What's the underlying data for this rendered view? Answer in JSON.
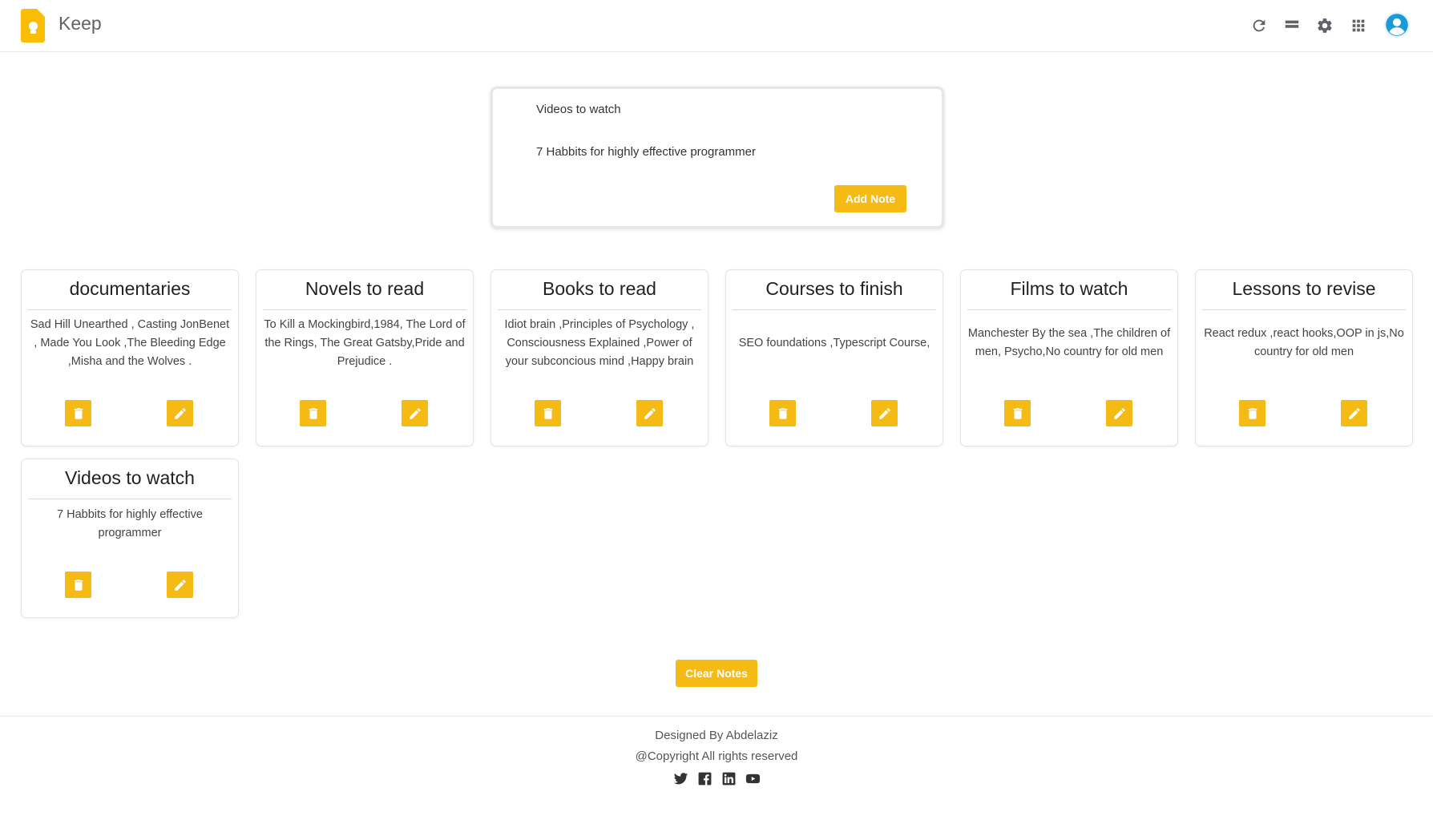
{
  "header": {
    "app_title": "Keep",
    "icons": [
      "refresh-icon",
      "list-view-icon",
      "settings-icon",
      "apps-grid-icon",
      "account-avatar"
    ]
  },
  "create_note": {
    "title_value": "Videos to watch",
    "content_value": "7 Habbits for highly effective programmer",
    "add_label": "Add Note"
  },
  "notes": [
    {
      "title": "documentaries",
      "content": "Sad Hill Unearthed , Casting JonBenet , Made You Look ,The Bleeding Edge ,Misha and the Wolves ."
    },
    {
      "title": "Novels to read",
      "content": "To Kill a Mockingbird,1984, The Lord of the Rings, The Great Gatsby,Pride and Prejudice ."
    },
    {
      "title": "Books to read",
      "content": "Idiot brain ,Principles of Psychology , Consciousness Explained ,Power of your subconcious mind ,Happy brain"
    },
    {
      "title": "Courses to finish",
      "content": "SEO foundations ,Typescript Course,"
    },
    {
      "title": "Films to watch",
      "content": "Manchester By the sea ,The children of men, Psycho,No country for old men"
    },
    {
      "title": "Lessons to revise",
      "content": "React redux ,react hooks,OOP in js,No country for old men"
    },
    {
      "title": "Videos to watch",
      "content": "7 Habbits for highly effective programmer"
    }
  ],
  "clear_label": "Clear Notes",
  "footer": {
    "designed_by": "Designed By Abdelaziz",
    "copyright": "@Copyright All rights reserved",
    "social_icons": [
      "twitter-icon",
      "facebook-icon",
      "linkedin-icon",
      "youtube-icon"
    ]
  },
  "colors": {
    "accent": "#f5ba13",
    "logo": "#fbbc04",
    "avatar": "#1a9bd7"
  }
}
